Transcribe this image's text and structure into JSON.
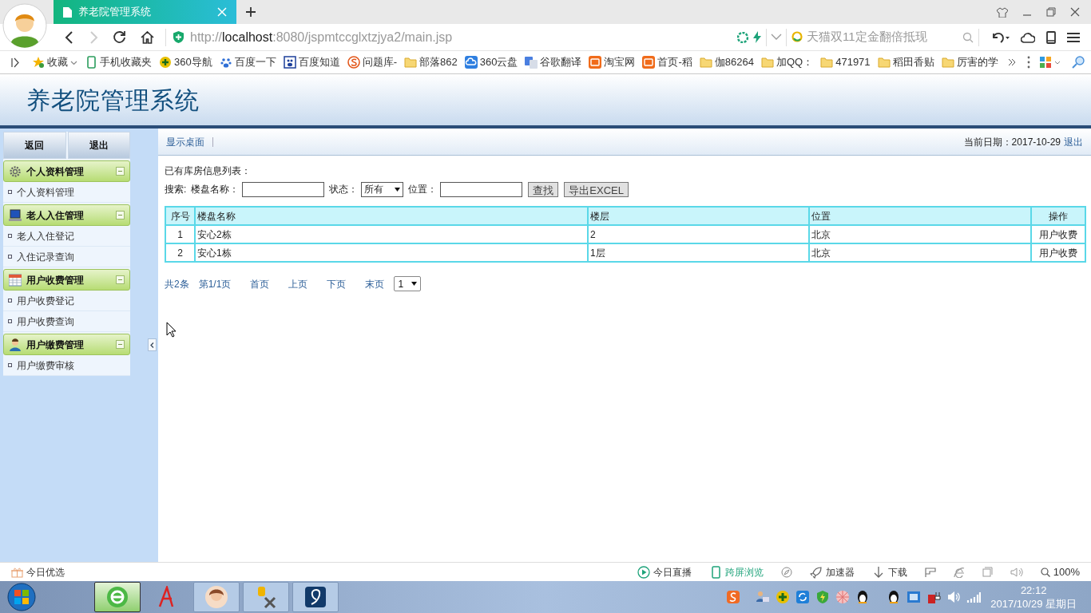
{
  "browser": {
    "tab_title": "养老院管理系统",
    "url": {
      "scheme": "http://",
      "host": "localhost",
      "path": ":8080/jspmtccglxtzjya2/main.jsp"
    },
    "search_placeholder": "天猫双11定金翻倍抵现",
    "bookmarks": [
      {
        "kind": "star",
        "label": "收藏"
      },
      {
        "kind": "phone",
        "label": "手机收藏夹"
      },
      {
        "kind": "nav",
        "label": "360导航"
      },
      {
        "kind": "paw",
        "label": "百度一下"
      },
      {
        "kind": "pawbox",
        "label": "百度知道"
      },
      {
        "kind": "sogou",
        "label": "问题库-"
      },
      {
        "kind": "folder",
        "label": "部落862"
      },
      {
        "kind": "cloud",
        "label": "360云盘"
      },
      {
        "kind": "translate",
        "label": "谷歌翻译"
      },
      {
        "kind": "taobao",
        "label": "淘宝网"
      },
      {
        "kind": "taobao",
        "label": "首页-稻"
      },
      {
        "kind": "folder",
        "label": "伽86264"
      },
      {
        "kind": "folder",
        "label": "加QQ："
      },
      {
        "kind": "folder",
        "label": "471971"
      },
      {
        "kind": "folder",
        "label": "稻田香贴"
      },
      {
        "kind": "folder",
        "label": "厉害的学"
      }
    ]
  },
  "header": {
    "title": "养老院管理系统"
  },
  "sidebar": {
    "buttons": [
      "返回",
      "退出"
    ],
    "sections": [
      {
        "kind": "gear",
        "title": "个人资料管理",
        "expanded": true,
        "items": [
          "个人资料管理"
        ]
      },
      {
        "kind": "laptop",
        "title": "老人入住管理",
        "expanded": true,
        "items": [
          "老人入住登记",
          "入住记录查询"
        ]
      },
      {
        "kind": "calendar",
        "title": "用户收费管理",
        "expanded": true,
        "items": [
          "用户收费登记",
          "用户收费查询"
        ]
      },
      {
        "kind": "person",
        "title": "用户缴费管理",
        "expanded": true,
        "items": [
          "用户缴费审核"
        ]
      }
    ]
  },
  "toolbar": {
    "link": "显示桌面",
    "date": "当前日期：2017-10-29",
    "logout": "退出"
  },
  "list_title": "已有库房信息列表：",
  "search": {
    "label": "搜索:",
    "fields": [
      {
        "kind": "text",
        "label": "楼盘名称："
      },
      {
        "kind": "select",
        "label": "状态：",
        "value": "所有"
      },
      {
        "kind": "text",
        "label": "位置："
      }
    ],
    "buttons": [
      "查找",
      "导出EXCEL"
    ]
  },
  "table": {
    "columns": [
      "序号",
      "楼盘名称",
      "楼层",
      "位置",
      "操作"
    ],
    "rows": [
      [
        "1",
        "安心2栋",
        "2",
        "北京",
        "用户收费"
      ],
      [
        "2",
        "安心1栋",
        "1层",
        "北京",
        "用户收费"
      ]
    ]
  },
  "pagination": {
    "total": "共2条",
    "page": "第1/1页",
    "links": [
      "首页",
      "上页",
      "下页",
      "末页"
    ],
    "page_select": "1"
  },
  "status_bar": {
    "left": "今日优选",
    "items": [
      {
        "kind": "play",
        "label": "今日直播"
      },
      {
        "kind": "phone",
        "label": "跨屏浏览"
      },
      {
        "kind": "rocket",
        "label": "加速器"
      },
      {
        "kind": "download",
        "label": "下载"
      }
    ],
    "zoom": "100%"
  },
  "taskbar": {
    "time": "22:12",
    "date": "2017/10/29 星期日"
  }
}
